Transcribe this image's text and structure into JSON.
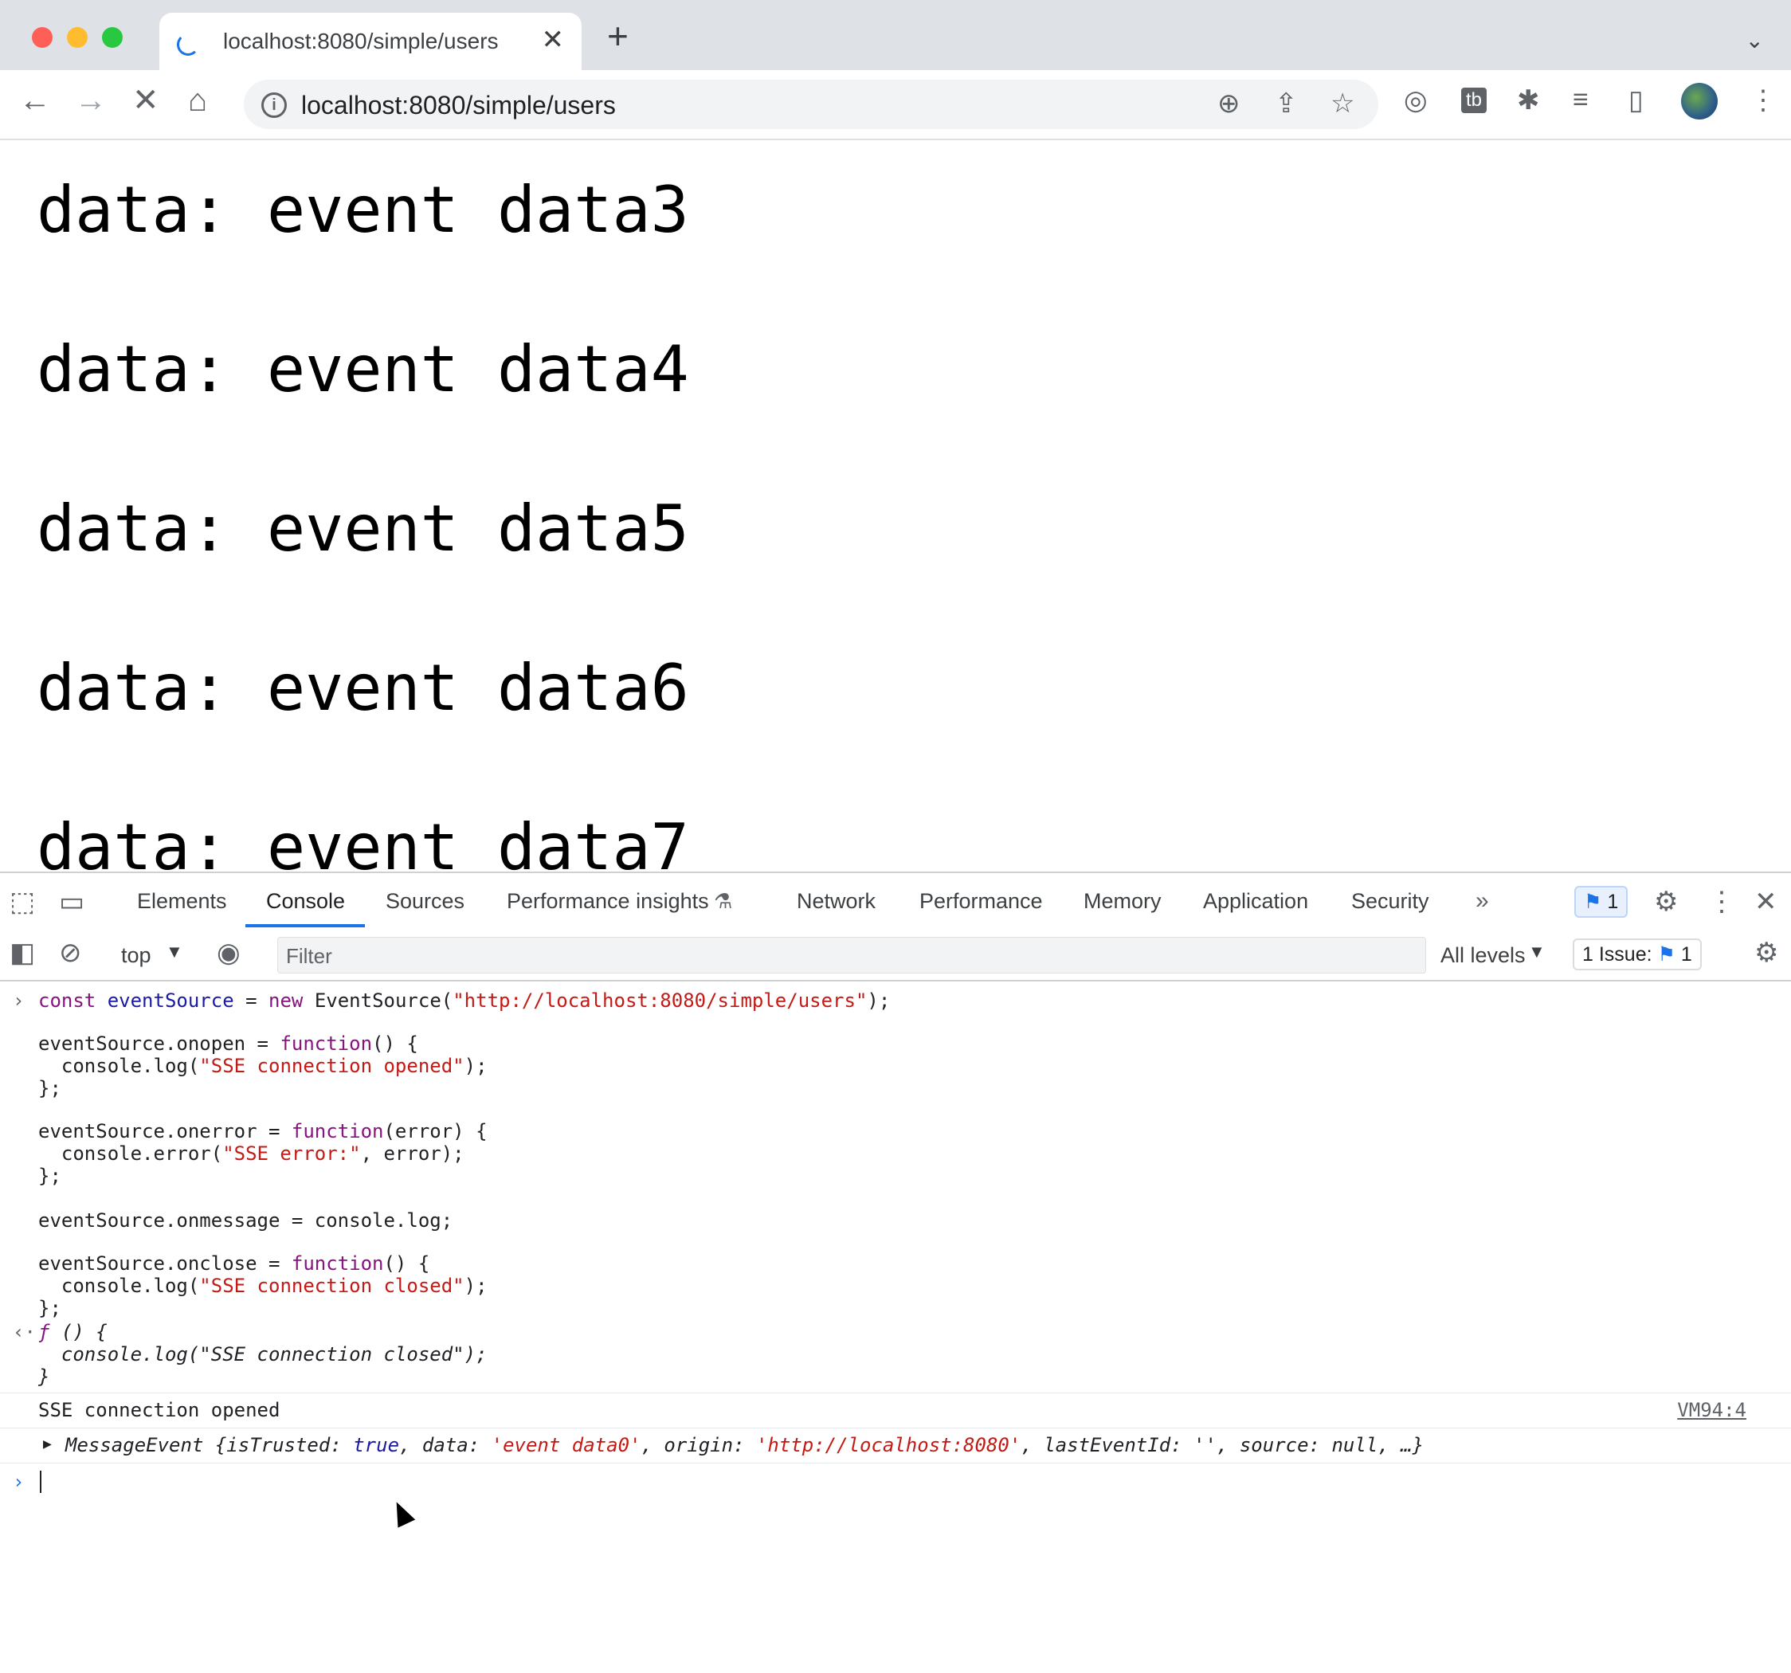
{
  "browser": {
    "tab_title": "localhost:8080/simple/users",
    "url": "localhost:8080/simple/users"
  },
  "page": {
    "lines": [
      "data: event data3",
      "data: event data4",
      "data: event data5",
      "data: event data6",
      "data: event data7"
    ]
  },
  "devtools": {
    "tabs": [
      "Elements",
      "Console",
      "Sources",
      "Performance insights",
      "Network",
      "Performance",
      "Memory",
      "Application",
      "Security"
    ],
    "active_tab": "Console",
    "messages_badge": "1",
    "context": "top",
    "filter_placeholder": "Filter",
    "levels": "All levels",
    "issues_label": "1 Issue:",
    "issues_count": "1"
  },
  "console": {
    "input_first": "const eventSource = new EventSource(\"http://localhost:8080/simple/users\");",
    "code": {
      "l1_a": "eventSource.onopen = ",
      "l1_kw": "function",
      "l1_b": "() {",
      "l2_a": "  console.log(",
      "l2_s": "\"SSE connection opened\"",
      "l2_b": ");",
      "l3": "};",
      "l4_a": "eventSource.onerror = ",
      "l4_kw": "function",
      "l4_b": "(error) {",
      "l5_a": "  console.error(",
      "l5_s": "\"SSE error:\"",
      "l5_b": ", error);",
      "l6": "};",
      "l7": "eventSource.onmessage = console.log;",
      "l8_a": "eventSource.onclose = ",
      "l8_kw": "function",
      "l8_b": "() {",
      "l9_a": "  console.log(",
      "l9_s": "\"SSE connection closed\"",
      "l9_b": ");",
      "l10": "};"
    },
    "result": {
      "r1_f": "ƒ",
      "r1_b": " () {",
      "r2": "  console.log(\"SSE connection closed\");",
      "r3": "}"
    },
    "log_opened": "SSE connection opened",
    "log_source": "VM94:4",
    "message_event": {
      "prefix": "MessageEvent {isTrusted: ",
      "trusted": "true",
      "mid1": ", data: ",
      "data": "'event data0'",
      "mid2": ", origin: ",
      "origin": "'http://localhost:8080'",
      "suffix": ", lastEventId: '', source: null, …}"
    }
  }
}
